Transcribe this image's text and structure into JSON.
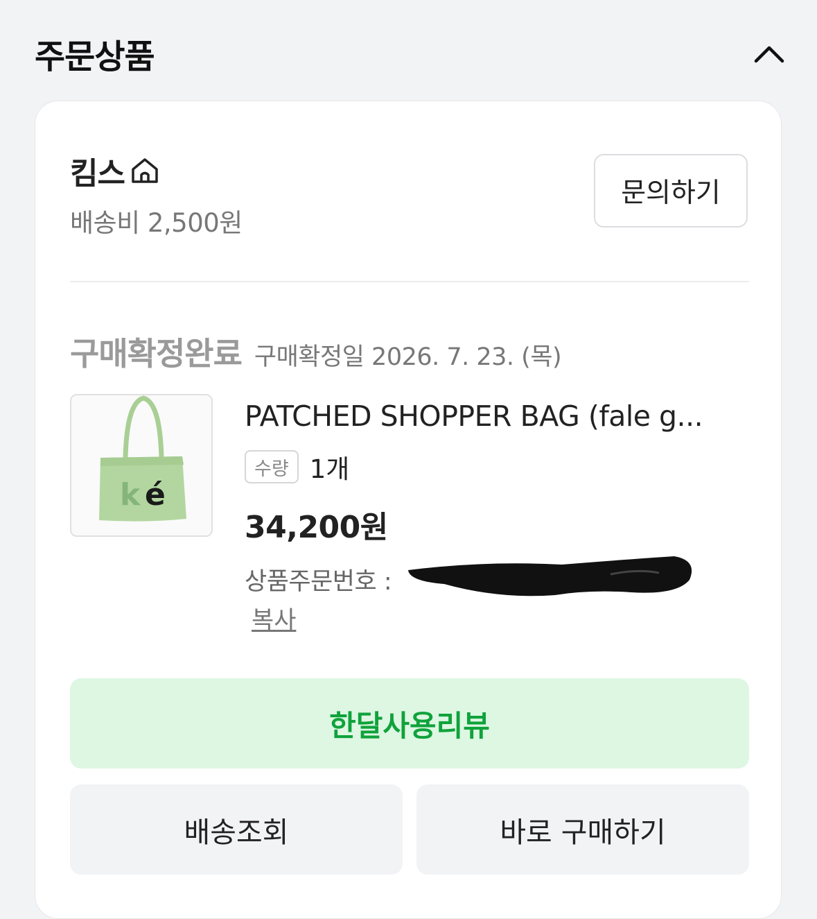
{
  "section": {
    "title": "주문상품"
  },
  "store": {
    "name": "킴스",
    "shipping_fee": "배송비 2,500원",
    "inquiry_label": "문의하기"
  },
  "order": {
    "status": "구매확정완료",
    "confirm_date": "구매확정일 2026. 7. 23. (목)",
    "product_name": "PATCHED SHOPPER BAG (fale g...",
    "qty_label": "수량",
    "qty_value": "1개",
    "price": "34,200원",
    "order_no_label": "상품주문번호 : ",
    "copy_label": "복사",
    "thumbnail_text": "ké"
  },
  "actions": {
    "review_label": "한달사용리뷰",
    "track_label": "배송조회",
    "buy_again_label": "바로 구매하기"
  },
  "icons": {
    "collapse": "chevron-up-icon",
    "store": "home-icon"
  },
  "colors": {
    "accent_green": "#10a23b",
    "review_bg": "#ddf7e3",
    "page_bg": "#f2f3f5"
  }
}
